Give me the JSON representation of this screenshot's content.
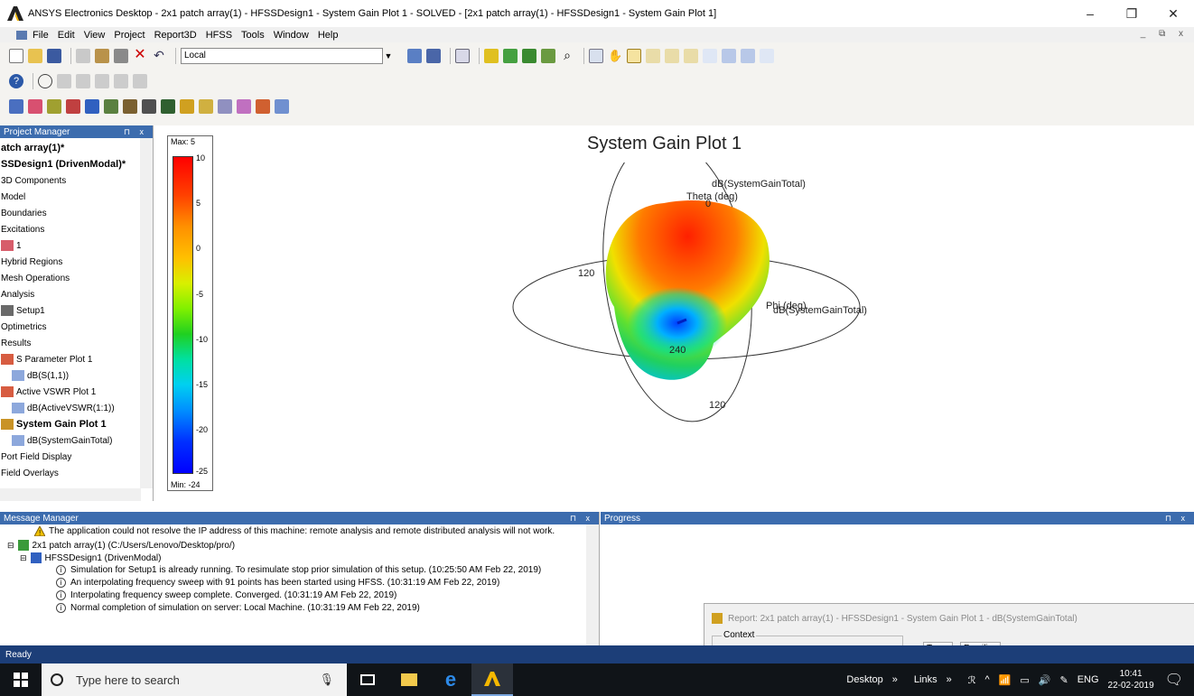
{
  "window": {
    "title": "ANSYS Electronics Desktop - 2x1 patch array(1) - HFSSDesign1 - System Gain Plot 1 - SOLVED - [2x1 patch array(1) - HFSSDesign1 - System Gain Plot 1]",
    "minimize_glyph": "–",
    "maximize_glyph": "❐",
    "close_glyph": "✕"
  },
  "menu": {
    "items": [
      "File",
      "Edit",
      "View",
      "Project",
      "Report3D",
      "HFSS",
      "Tools",
      "Window",
      "Help"
    ],
    "mdi_controls": "_ ⧉ x"
  },
  "toolbar": {
    "solver_combo": "Local"
  },
  "project_manager": {
    "header": "Project Manager",
    "pin": "⊓ x",
    "items": [
      {
        "label": "atch array(1)*",
        "bold": true,
        "indent": 0,
        "icon": ""
      },
      {
        "label": "SSDesign1 (DrivenModal)*",
        "bold": true,
        "indent": 0,
        "icon": ""
      },
      {
        "label": "3D Components",
        "bold": false,
        "indent": 0,
        "icon": ""
      },
      {
        "label": "Model",
        "bold": false,
        "indent": 0,
        "icon": ""
      },
      {
        "label": "Boundaries",
        "bold": false,
        "indent": 0,
        "icon": ""
      },
      {
        "label": "Excitations",
        "bold": false,
        "indent": 0,
        "icon": ""
      },
      {
        "label": "1",
        "bold": false,
        "indent": 0,
        "icon": "port-icon"
      },
      {
        "label": "Hybrid Regions",
        "bold": false,
        "indent": 0,
        "icon": ""
      },
      {
        "label": "Mesh Operations",
        "bold": false,
        "indent": 0,
        "icon": ""
      },
      {
        "label": "Analysis",
        "bold": false,
        "indent": 0,
        "icon": ""
      },
      {
        "label": "Setup1",
        "bold": false,
        "indent": 0,
        "icon": "setup-icon"
      },
      {
        "label": "Optimetrics",
        "bold": false,
        "indent": 0,
        "icon": ""
      },
      {
        "label": "Results",
        "bold": false,
        "indent": 0,
        "icon": ""
      },
      {
        "label": "S Parameter Plot 1",
        "bold": false,
        "indent": 0,
        "icon": "plot-icon"
      },
      {
        "label": "dB(S(1,1))",
        "bold": false,
        "indent": 1,
        "icon": "trace-icon"
      },
      {
        "label": "Active VSWR Plot 1",
        "bold": false,
        "indent": 0,
        "icon": "plot-icon"
      },
      {
        "label": "dB(ActiveVSWR(1:1))",
        "bold": false,
        "indent": 1,
        "icon": "trace-icon"
      },
      {
        "label": "System Gain Plot 1",
        "bold": true,
        "indent": 0,
        "icon": "3d-plot-icon"
      },
      {
        "label": "dB(SystemGainTotal)",
        "bold": false,
        "indent": 1,
        "icon": "trace-icon"
      },
      {
        "label": "Port Field Display",
        "bold": false,
        "indent": 0,
        "icon": ""
      },
      {
        "label": "Field Overlays",
        "bold": false,
        "indent": 0,
        "icon": ""
      }
    ]
  },
  "plot": {
    "title": "System Gain Plot 1",
    "legend": {
      "max_label": "Max: 5",
      "min_label": "Min: -24",
      "ticks": [
        "10",
        "5",
        "0",
        "-5",
        "-10",
        "-15",
        "-20",
        "-25"
      ]
    },
    "annotations": {
      "trace_label": "dB(SystemGainTotal)",
      "theta_label": "Theta (deg)",
      "theta_zero": "0",
      "phi_label": "Phi (deg)",
      "phi_trace_label": "dB(SystemGainTotal)",
      "label_120_left": "120",
      "label_240": "240",
      "label_120_bottom": "120"
    }
  },
  "message_manager": {
    "header": "Message Manager",
    "pin": "⊓ x",
    "lines": [
      {
        "text": "The application could not resolve the IP address of this machine: remote analysis and remote distributed analysis will not work.",
        "level": "warning"
      },
      {
        "text": "2x1 patch array(1) (C:/Users/Lenovo/Desktop/pro/)",
        "level": "project"
      },
      {
        "text": "HFSSDesign1 (DrivenModal)",
        "level": "design"
      },
      {
        "text": "Simulation for Setup1 is already running. To resimulate stop prior simulation of this setup. (10:25:50 AM  Feb 22, 2019)",
        "level": "info"
      },
      {
        "text": "An interpolating frequency sweep with 91 points has been started using HFSS. (10:31:19 AM  Feb 22, 2019)",
        "level": "info"
      },
      {
        "text": "Interpolating frequency sweep complete. Converged. (10:31:19 AM  Feb 22, 2019)",
        "level": "info"
      },
      {
        "text": "Normal completion of simulation on server: Local Machine. (10:31:19 AM  Feb 22, 2019)",
        "level": "info"
      }
    ]
  },
  "progress": {
    "header": "Progress",
    "pin": "⊓ x"
  },
  "report_dialog": {
    "title": "Report: 2x1 patch array(1) - HFSSDesign1 - System Gain Plot 1 - dB(SystemGainTotal)",
    "context_label": "Context",
    "tabs": [
      "Trace",
      "Families"
    ]
  },
  "status": {
    "text": "Ready"
  },
  "taskbar": {
    "search_placeholder": "Type here to search",
    "desktop_label": "Desktop",
    "links_label": "Links",
    "language": "ENG",
    "time": "10:41",
    "date": "22-02-2019"
  },
  "colors": {
    "panel_header": "#3c6cae",
    "statusbar": "#1c3e78",
    "taskbar": "#101418"
  }
}
